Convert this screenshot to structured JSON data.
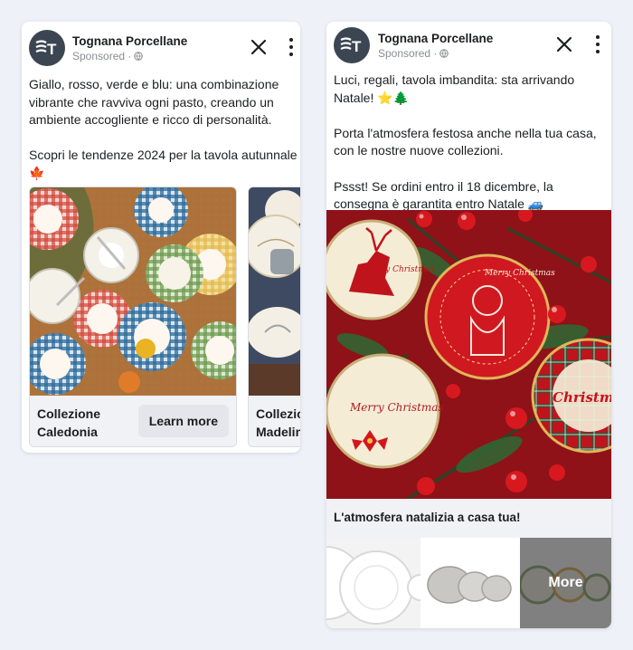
{
  "ad_left": {
    "brand": "Tognana Porcellane",
    "sponsored": "Sponsored ·",
    "paragraphs": [
      "Giallo, rosso, verde e blu: una combinazione vibrante che ravviva ogni pasto, creando un ambiente accogliente e ricco di personalità.",
      "Scopri le tendenze 2024 per la tavola autunnale 🍁"
    ],
    "carousel": [
      {
        "title": "Collezione Caledonia",
        "cta": "Learn more"
      },
      {
        "title": "Collezione Madelin"
      }
    ]
  },
  "ad_right": {
    "brand": "Tognana Porcellane",
    "sponsored": "Sponsored ·",
    "paragraphs": [
      "Luci, regali, tavola imbandita: sta arrivando Natale! ⭐🌲",
      "Porta l'atmosfera festosa anche nella tua casa, con le nostre nuove collezioni.",
      "Pssst! Se ordini entro il 18 dicembre, la consegna è garantita entro Natale 🚙"
    ],
    "caption": "L'atmosfera natalizia a casa tua!",
    "more_label": "More",
    "plate_texts": [
      "Merry Christmas",
      "Merry Christmas",
      "Merry Christmas",
      "Christmas"
    ]
  },
  "icons": {
    "close": "close-icon",
    "more": "more-vertical-icon",
    "globe": "globe-icon",
    "avatar": "tognana-logo-icon"
  },
  "colors": {
    "background": "#eef2f8",
    "card": "#ffffff",
    "button": "#e4e6eb",
    "muted": "#8a8d91",
    "christmas_red": "#c0141c",
    "christmas_green": "#1e4a2a"
  }
}
